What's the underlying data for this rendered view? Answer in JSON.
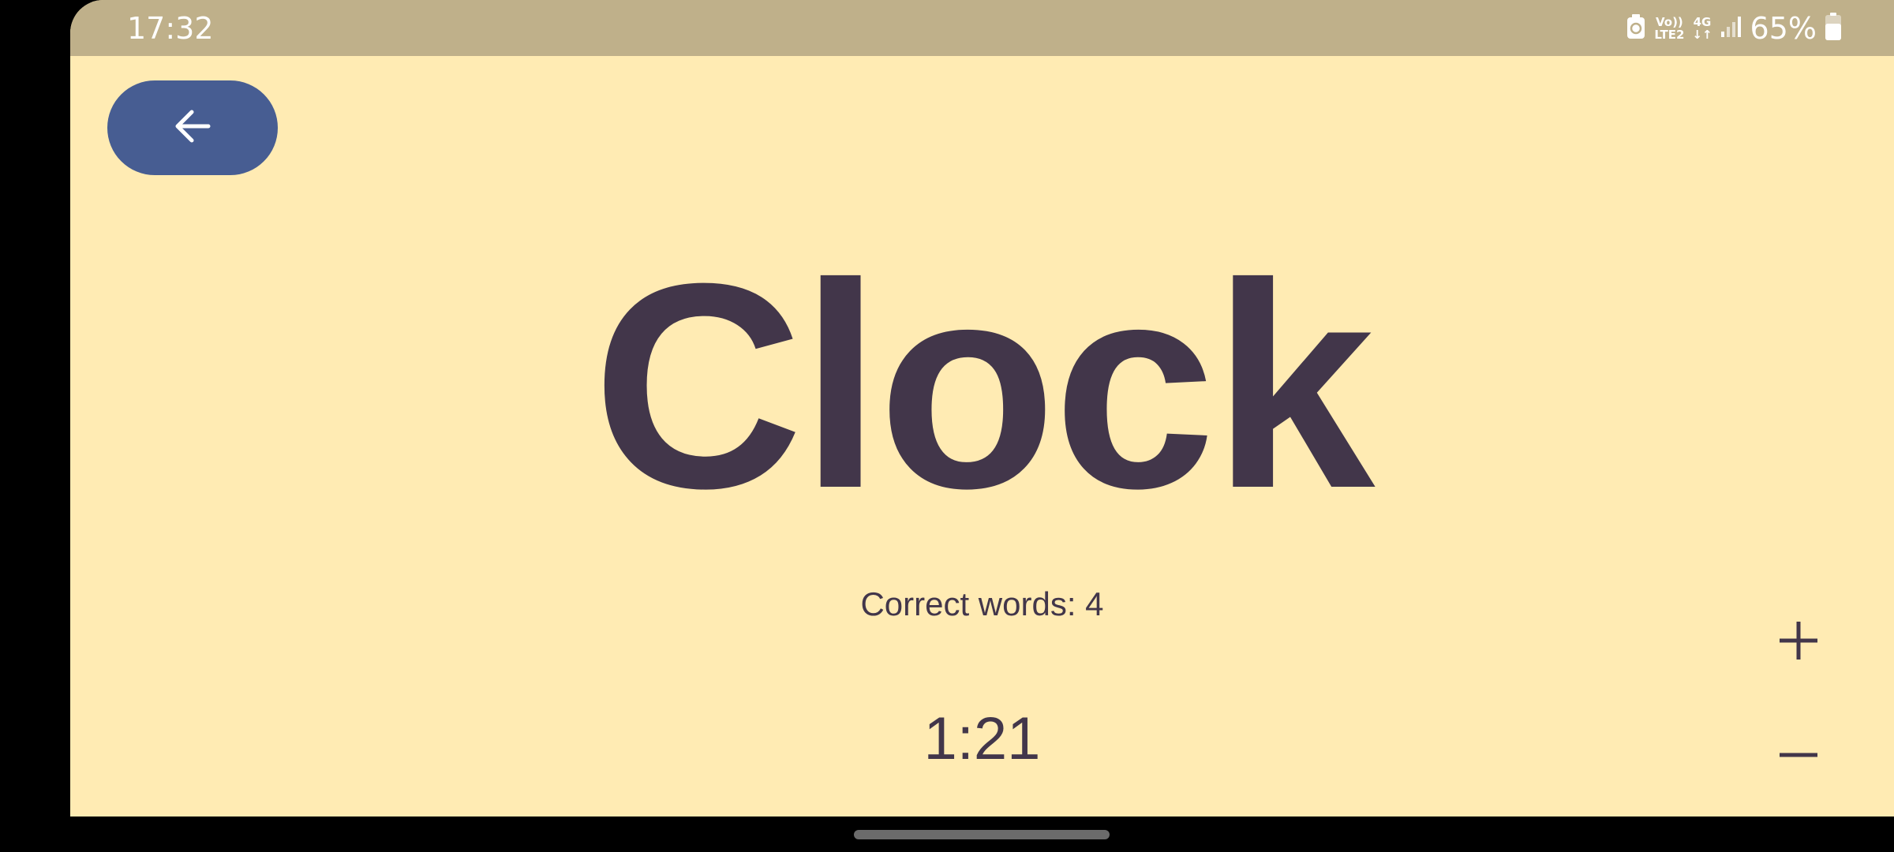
{
  "status_bar": {
    "time": "17:32",
    "volte_line1": "Vo))",
    "volte_line2": "LTE2",
    "network": "4G",
    "network_arrows": "↓↑",
    "battery_percent": "65%"
  },
  "game": {
    "word": "Clock",
    "correct_words_label": "Correct words: 4",
    "timer": "1:21"
  },
  "icons": {
    "back": "arrow-left-icon",
    "increase": "plus-icon",
    "decrease": "minus-icon"
  },
  "colors": {
    "background": "#FFEBB3",
    "status_bar": "#BFB08A",
    "back_button": "#475D92",
    "text": "#42364A"
  }
}
